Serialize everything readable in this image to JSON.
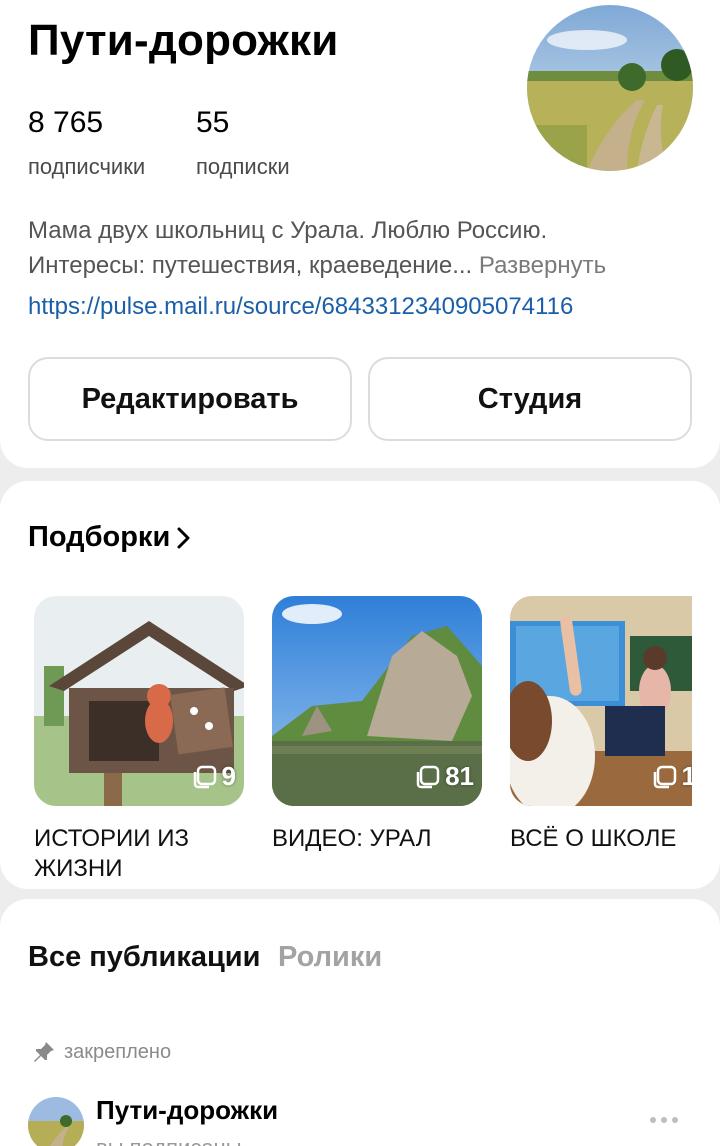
{
  "profile": {
    "name": "Пути-дорожки",
    "stats": [
      {
        "value": "8 765",
        "label": "подписчики"
      },
      {
        "value": "55",
        "label": "подписки"
      }
    ],
    "bio_line1": "Мама двух школьниц с Урала. Люблю Россию.",
    "bio_line2": "Интересы: путешествия, краеведение...",
    "bio_more": "Развернуть",
    "link": "https://pulse.mail.ru/source/6843312340905074116",
    "buttons": {
      "edit": "Редактировать",
      "studio": "Студия"
    }
  },
  "collections": {
    "title": "Подборки",
    "items": [
      {
        "label": "ИСТОРИИ ИЗ ЖИЗНИ",
        "count": "9"
      },
      {
        "label": "ВИДЕО: УРАЛ",
        "count": "81"
      },
      {
        "label": "ВСЁ О ШКОЛЕ",
        "count": "1"
      }
    ]
  },
  "feed": {
    "tabs": [
      "Все публикации",
      "Ролики"
    ],
    "pinned_label": "закреплено",
    "post": {
      "author": "Пути-дорожки",
      "subtitle": "вы подписаны"
    }
  },
  "colors": {
    "link": "#1b5fa8",
    "background": "#ededed",
    "card": "#ffffff"
  }
}
